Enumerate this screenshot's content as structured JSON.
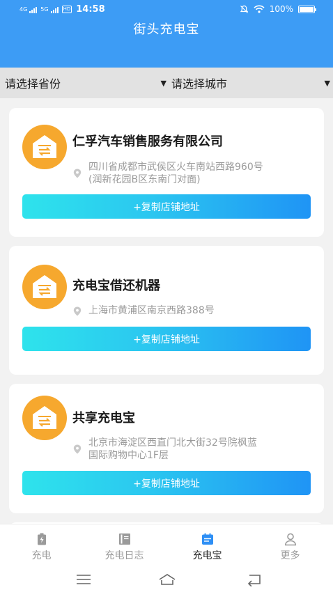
{
  "status_bar": {
    "net_1": "4G",
    "net_2": "5G",
    "hd": "HD",
    "time": "14:58",
    "battery": "100%",
    "icons": [
      "signal-icon",
      "signal-icon",
      "mute-icon",
      "wifi-icon",
      "battery-icon"
    ]
  },
  "header": {
    "title": "街头充电宝"
  },
  "filters": {
    "province": "请选择省份",
    "city": "请选择城市"
  },
  "stores": [
    {
      "name": "仁孚汽车销售服务有限公司",
      "address_lines": [
        "四川省成都市武侯区火车南站西路960号",
        "(润新花园B区东南门对面)"
      ],
      "button_label": "+复制店铺地址"
    },
    {
      "name": "充电宝借还机器",
      "address_lines": [
        "上海市黄浦区南京西路388号"
      ],
      "button_label": "+复制店铺地址"
    },
    {
      "name": "共享充电宝",
      "address_lines": [
        "北京市海淀区西直门北大街32号院枫蓝",
        "国际购物中心1F层"
      ],
      "button_label": "+复制店铺地址"
    }
  ],
  "tabs": [
    {
      "label": "充电",
      "icon": "battery-charge-icon",
      "active": false
    },
    {
      "label": "充电日志",
      "icon": "book-icon",
      "active": false
    },
    {
      "label": "充电宝",
      "icon": "calendar-icon",
      "active": true
    },
    {
      "label": "更多",
      "icon": "user-icon",
      "active": false
    }
  ],
  "colors": {
    "header": "#3d9cf5",
    "icon_orange": "#f6a82e",
    "button_start": "#2ee3ec",
    "button_end": "#1f94f5",
    "tab_active_icon": "#2e8ff5",
    "tab_inactive": "#9a9a9a"
  }
}
